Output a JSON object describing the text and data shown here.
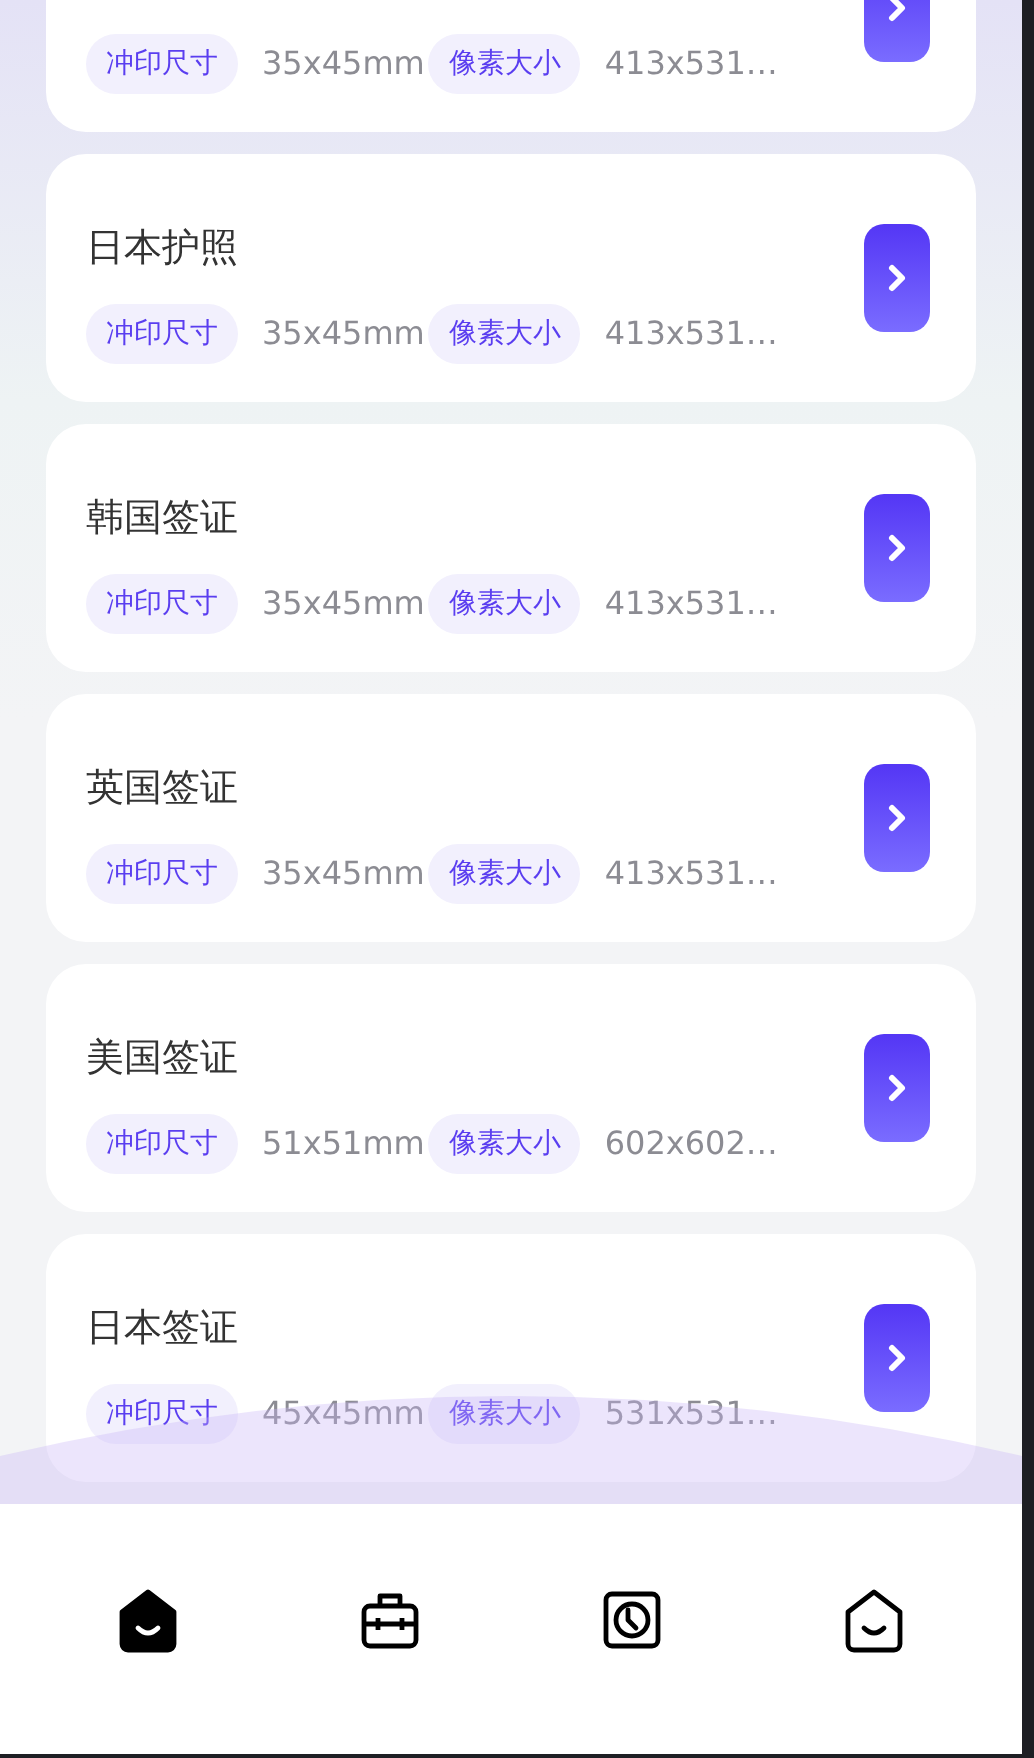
{
  "cards": [
    {
      "print_label": "冲印尺寸",
      "print_size": "35x45mm",
      "pixel_label": "像素大小",
      "pixel_size": "413x531…"
    },
    {
      "title": "日本护照",
      "print_label": "冲印尺寸",
      "print_size": "35x45mm",
      "pixel_label": "像素大小",
      "pixel_size": "413x531…"
    },
    {
      "title": "韩国签证",
      "print_label": "冲印尺寸",
      "print_size": "35x45mm",
      "pixel_label": "像素大小",
      "pixel_size": "413x531…"
    },
    {
      "title": "英国签证",
      "print_label": "冲印尺寸",
      "print_size": "35x45mm",
      "pixel_label": "像素大小",
      "pixel_size": "413x531…"
    },
    {
      "title": "美国签证",
      "print_label": "冲印尺寸",
      "print_size": "51x51mm",
      "pixel_label": "像素大小",
      "pixel_size": "602x602…"
    },
    {
      "title": "日本签证",
      "print_label": "冲印尺寸",
      "print_size": "45x45mm",
      "pixel_label": "像素大小",
      "pixel_size": "531x531…"
    }
  ],
  "tab_bar": [
    {
      "kind": "home",
      "selected": true
    },
    {
      "kind": "toolbox",
      "selected": false
    },
    {
      "kind": "clock",
      "selected": false
    },
    {
      "kind": "profile",
      "selected": false
    }
  ]
}
